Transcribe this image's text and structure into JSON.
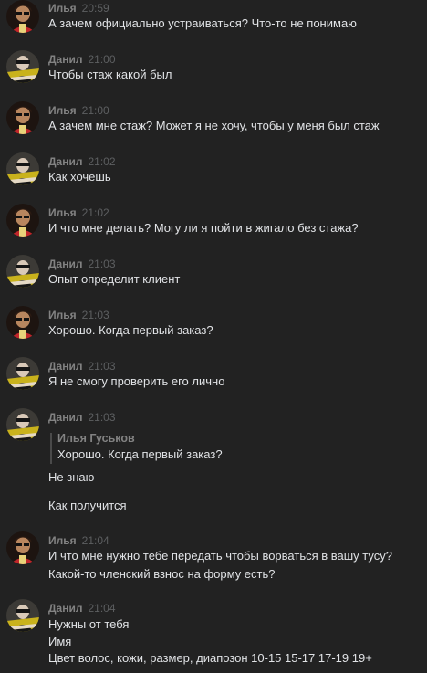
{
  "icons": {
    "ilya_avatar": "ilya-avatar-icon",
    "danil_avatar": "danil-avatar-icon"
  },
  "colors": {
    "background": "#222222",
    "author": "#828282",
    "time": "#5d5f61",
    "text": "#e1e3e6"
  },
  "messages": [
    {
      "author": "Илья",
      "time": "20:59",
      "lines": [
        "А зачем официально устраиваться? Что-то не понимаю"
      ]
    },
    {
      "author": "Данил",
      "time": "21:00",
      "lines": [
        "Чтобы стаж какой был"
      ]
    },
    {
      "author": "Илья",
      "time": "21:00",
      "lines": [
        "А зачем мне стаж? Может я не хочу, чтобы у меня был стаж"
      ]
    },
    {
      "author": "Данил",
      "time": "21:02",
      "lines": [
        "Как хочешь"
      ]
    },
    {
      "author": "Илья",
      "time": "21:02",
      "lines": [
        "И что мне делать? Могу ли я пойти в жигало без стажа?"
      ]
    },
    {
      "author": "Данил",
      "time": "21:03",
      "lines": [
        "Опыт определит клиент"
      ]
    },
    {
      "author": "Илья",
      "time": "21:03",
      "lines": [
        "Хорошо. Когда первый заказ?"
      ]
    },
    {
      "author": "Данил",
      "time": "21:03",
      "lines": [
        "Я не смогу проверить его лично"
      ]
    },
    {
      "author": "Данил",
      "time": "21:03",
      "quote": {
        "author": "Илья Гуськов",
        "text": "Хорошо. Когда первый заказ?"
      },
      "lines": [
        "Не знаю",
        "Как получится"
      ]
    },
    {
      "author": "Илья",
      "time": "21:04",
      "lines": [
        "И что мне нужно тебе передать чтобы ворваться в вашу тусу?",
        "Какой-то членский взнос на форму есть?"
      ]
    },
    {
      "author": "Данил",
      "time": "21:04",
      "lines": [
        "Нужны от тебя",
        "Имя",
        "Цвет волос, кожи, размер, диапозон 10-15 15-17 17-19 19+"
      ]
    }
  ]
}
